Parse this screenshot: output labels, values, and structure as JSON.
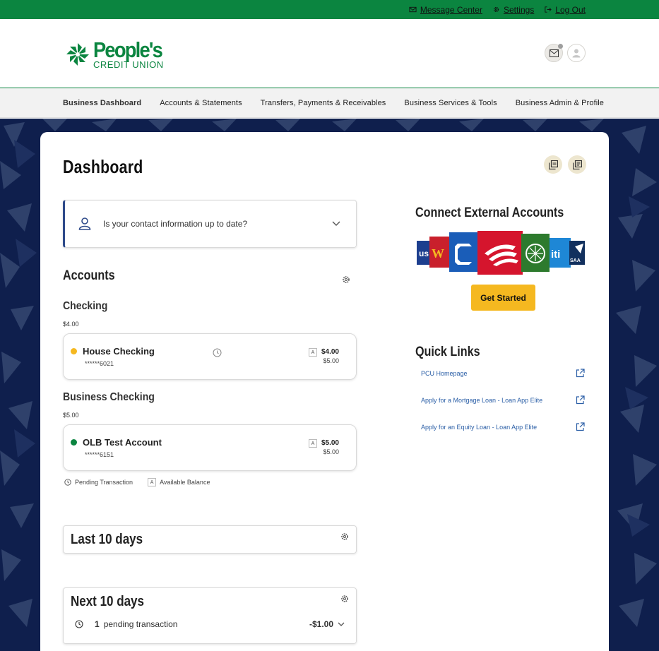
{
  "util_nav": {
    "message_center": "Message Center",
    "settings": "Settings",
    "log_out": "Log Out"
  },
  "brand": {
    "name": "People's",
    "sub": "CREDIT UNION",
    "color": "#0b8540"
  },
  "main_nav": [
    {
      "label": "Business Dashboard",
      "active": true
    },
    {
      "label": "Accounts & Statements"
    },
    {
      "label": "Transfers, Payments & Receivables"
    },
    {
      "label": "Business Services & Tools"
    },
    {
      "label": "Business Admin & Profile"
    }
  ],
  "page": {
    "title": "Dashboard"
  },
  "contact_prompt": "Is your contact information up to date?",
  "accounts": {
    "heading": "Accounts",
    "groups": [
      {
        "name": "Checking",
        "total": "$4.00",
        "items": [
          {
            "name": "House Checking",
            "number": "******6021",
            "balance": "$4.00",
            "available": "$5.00",
            "status_color": "#f5b820",
            "pending_icon": true
          }
        ]
      },
      {
        "name": "Business Checking",
        "total": "$5.00",
        "items": [
          {
            "name": "OLB Test Account",
            "number": "******6151",
            "balance": "$5.00",
            "available": "$5.00",
            "status_color": "#0b8540",
            "pending_icon": false
          }
        ]
      }
    ],
    "legend": {
      "pending": "Pending Transaction",
      "available": "Available Balance",
      "a_badge": "A"
    }
  },
  "last10": {
    "title": "Last 10 days"
  },
  "next10": {
    "title": "Next 10 days",
    "pending_count": "1",
    "pending_label": "pending transaction",
    "pending_amount": "-$1.00"
  },
  "external": {
    "heading": "Connect External Accounts",
    "cta": "Get Started",
    "logo_text": {
      "usaa": "us",
      "citi": "iti",
      "usaa2": "SAA"
    }
  },
  "quick_links": {
    "heading": "Quick Links",
    "items": [
      "PCU Homepage",
      "Apply for a Mortgage Loan - Loan App Elite",
      "Apply for an Equity Loan - Loan App Elite"
    ]
  },
  "colors": {
    "accent_green": "#0b8540",
    "navy_bg": "#0f1f4d",
    "cta_yellow": "#f5b820",
    "link_blue": "#2a5ea6"
  }
}
